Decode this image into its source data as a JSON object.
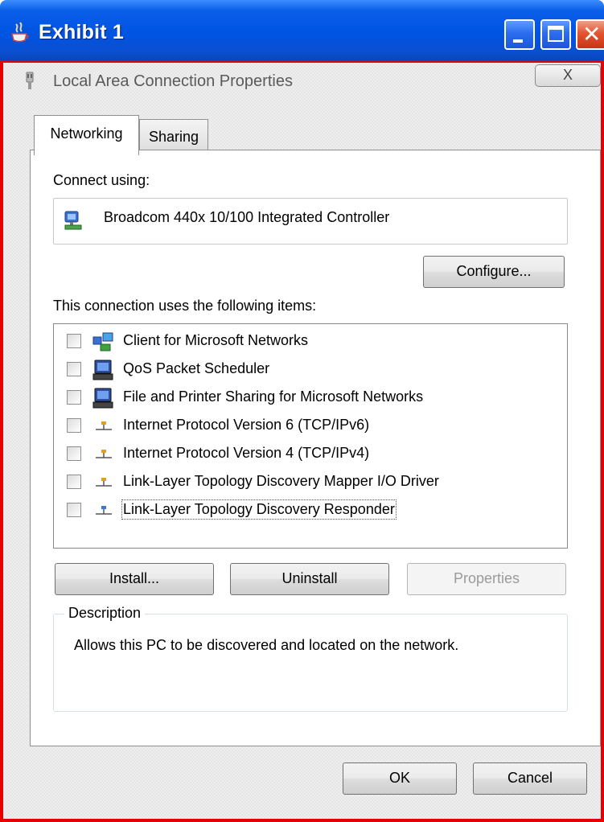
{
  "outer_window": {
    "title": "Exhibit 1"
  },
  "dialog": {
    "title": "Local Area Connection Properties",
    "close_glyph": "X"
  },
  "tabs": [
    {
      "label": "Networking",
      "active": true
    },
    {
      "label": "Sharing",
      "active": false
    }
  ],
  "connect_using": {
    "label": "Connect using:",
    "adapter_name": "Broadcom 440x 10/100 Integrated Controller",
    "configure_label": "Configure..."
  },
  "items_section": {
    "label": "This connection uses the following items:",
    "items": [
      {
        "label": "Client for Microsoft Networks",
        "icon": "network-client-icon",
        "checked": false
      },
      {
        "label": "QoS Packet Scheduler",
        "icon": "computer-service-icon",
        "checked": false
      },
      {
        "label": "File and Printer Sharing for Microsoft Networks",
        "icon": "computer-service-icon",
        "checked": false
      },
      {
        "label": "Internet Protocol Version 6 (TCP/IPv6)",
        "icon": "protocol-icon",
        "checked": false
      },
      {
        "label": "Internet Protocol Version 4 (TCP/IPv4)",
        "icon": "protocol-icon",
        "checked": false
      },
      {
        "label": "Link-Layer Topology Discovery Mapper I/O Driver",
        "icon": "protocol-icon",
        "checked": false
      },
      {
        "label": "Link-Layer Topology Discovery Responder",
        "icon": "protocol-blue-icon",
        "checked": false,
        "selected": true
      }
    ]
  },
  "action_buttons": {
    "install": "Install...",
    "uninstall": "Uninstall",
    "properties": "Properties"
  },
  "description": {
    "legend": "Description",
    "text": "Allows this PC to be discovered and located on the network."
  },
  "footer": {
    "ok": "OK",
    "cancel": "Cancel"
  },
  "colors": {
    "titlebar_blue": "#0054e3",
    "frame_red": "#e60000",
    "close_red": "#e2552f"
  }
}
